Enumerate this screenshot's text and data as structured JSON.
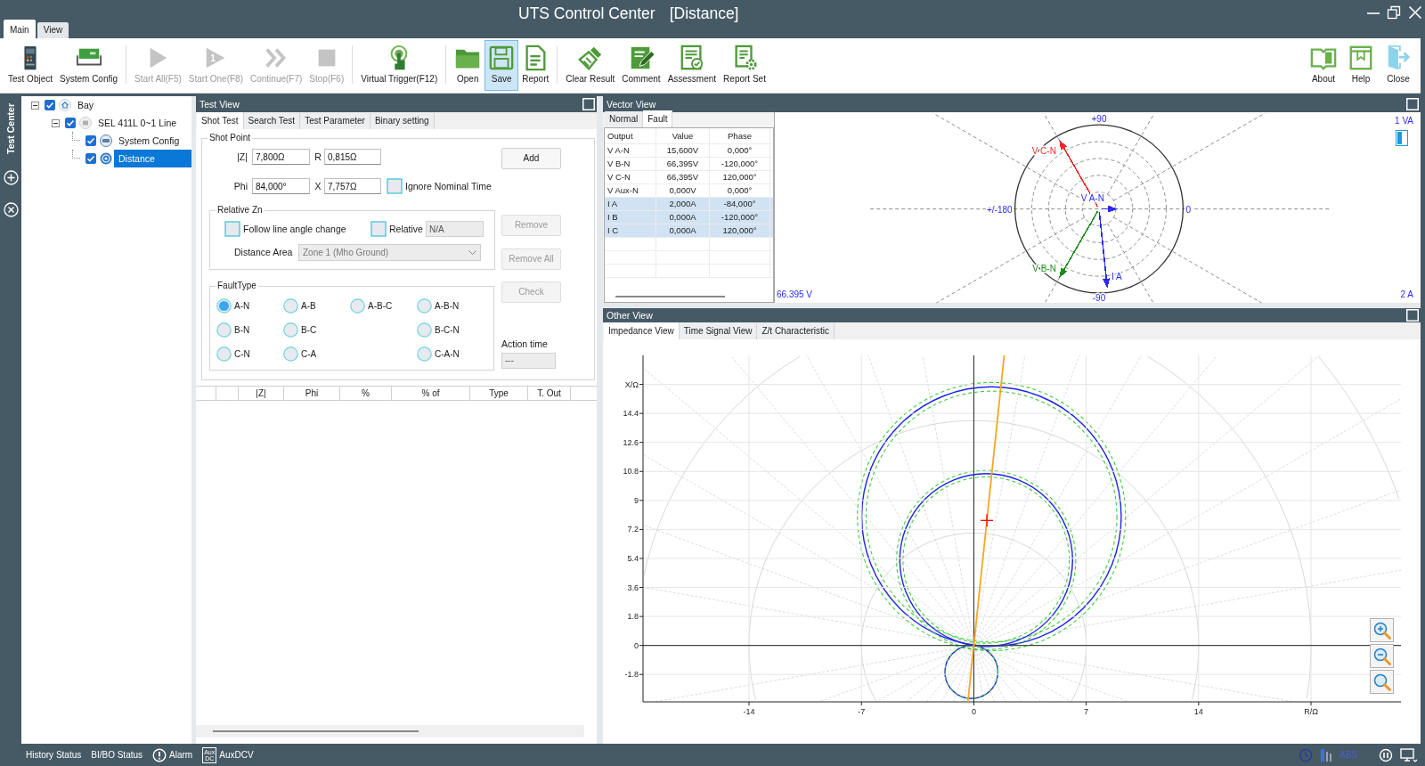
{
  "window": {
    "title": "UTS Control Center",
    "document": "[Distance]"
  },
  "ribbon_tabs": [
    {
      "label": "Main",
      "selected": true
    },
    {
      "label": "View",
      "selected": false
    }
  ],
  "toolbar": {
    "groups": [
      {
        "items": [
          {
            "label": "Test Object",
            "disabled": false,
            "selected": false
          },
          {
            "label": "System Config",
            "disabled": false,
            "selected": false
          }
        ]
      },
      {
        "items": [
          {
            "label": "Start All(F5)",
            "disabled": true,
            "selected": false
          },
          {
            "label": "Start One(F8)",
            "disabled": true,
            "selected": false,
            "icon_text": "1"
          },
          {
            "label": "Continue(F7)",
            "disabled": true,
            "selected": false
          },
          {
            "label": "Stop(F6)",
            "disabled": true,
            "selected": false
          }
        ]
      },
      {
        "items": [
          {
            "label": "Virtual Trigger(F12)",
            "disabled": false,
            "selected": false
          }
        ]
      },
      {
        "items": [
          {
            "label": "Open",
            "disabled": false,
            "selected": false
          },
          {
            "label": "Save",
            "disabled": false,
            "selected": true
          },
          {
            "label": "Report",
            "disabled": false,
            "selected": false
          }
        ]
      },
      {
        "items": [
          {
            "label": "Clear Result",
            "disabled": false,
            "selected": false
          },
          {
            "label": "Comment",
            "disabled": false,
            "selected": false
          },
          {
            "label": "Assessment",
            "disabled": false,
            "selected": false
          },
          {
            "label": "Report Set",
            "disabled": false,
            "selected": false
          }
        ]
      }
    ],
    "right": [
      {
        "label": "About",
        "disabled": false,
        "selected": false
      },
      {
        "label": "Help",
        "disabled": false,
        "selected": false
      },
      {
        "label": "Close",
        "disabled": false,
        "selected": false
      }
    ]
  },
  "side_strip": {
    "label": "Test Center"
  },
  "tree": [
    {
      "label": "Bay",
      "kind": "bay",
      "checked": true,
      "expanded": true,
      "selected": false,
      "children": [
        {
          "label": "SEL 411L 0~1 Line",
          "kind": "device",
          "checked": true,
          "expanded": true,
          "selected": false,
          "children": [
            {
              "label": "System Config",
              "kind": "config",
              "checked": true,
              "selected": false
            },
            {
              "label": "Distance",
              "kind": "test",
              "checked": true,
              "selected": true
            }
          ]
        }
      ]
    }
  ],
  "test_view": {
    "title": "Test View",
    "tabs": [
      {
        "label": "Shot Test",
        "selected": true
      },
      {
        "label": "Search Test",
        "selected": false
      },
      {
        "label": "Test Parameter",
        "selected": false
      },
      {
        "label": "Binary setting",
        "selected": false
      }
    ],
    "shot_point": {
      "legend": "Shot Point",
      "z": {
        "label": "|Z|",
        "value": "7,800Ω"
      },
      "r": {
        "label": "R",
        "value": "0,815Ω"
      },
      "phi": {
        "label": "Phi",
        "value": "84,000°"
      },
      "x": {
        "label": "X",
        "value": "7,757Ω"
      },
      "ignore_nominal_time": {
        "label": "Ignore Nominal Time",
        "checked": false
      },
      "relative_zn": {
        "legend": "Relative Zn",
        "follow_line_angle": {
          "label": "Follow line angle change",
          "checked": false
        },
        "relative": {
          "label": "Relative",
          "checked": false,
          "value": "N/A",
          "disabled": true
        },
        "distance_area": {
          "label": "Distance Area",
          "value": "Zone 1 (Mho Ground)",
          "disabled": true
        }
      },
      "fault_type": {
        "legend": "FaultType",
        "columns": [
          [
            {
              "label": "A-N",
              "selected": true
            },
            {
              "label": "B-N",
              "selected": false
            },
            {
              "label": "C-N",
              "selected": false
            }
          ],
          [
            {
              "label": "A-B",
              "selected": false
            },
            {
              "label": "B-C",
              "selected": false
            },
            {
              "label": "C-A",
              "selected": false
            }
          ],
          [
            {
              "label": "A-B-C",
              "selected": false
            }
          ],
          [
            {
              "label": "A-B-N",
              "selected": false
            },
            {
              "label": "B-C-N",
              "selected": false
            },
            {
              "label": "C-A-N",
              "selected": false
            }
          ]
        ]
      },
      "buttons": [
        {
          "label": "Add",
          "disabled": false
        },
        {
          "label": "Remove",
          "disabled": true
        },
        {
          "label": "Remove All",
          "disabled": true
        },
        {
          "label": "Check",
          "disabled": true
        }
      ],
      "action_time": {
        "label": "Action time",
        "value": "---",
        "disabled": true
      }
    },
    "result_table": {
      "columns": [
        "|Z|",
        "Phi",
        "%",
        "% of",
        "Type",
        "T. Out"
      ]
    }
  },
  "vector_view": {
    "title": "Vector View",
    "tabs": [
      {
        "label": "Normal",
        "selected": false
      },
      {
        "label": "Fault",
        "selected": true
      }
    ],
    "table": {
      "columns": [
        "Output",
        "Value",
        "Phase"
      ],
      "rows": [
        {
          "cells": [
            "V A-N",
            "15,600V",
            "0,000°"
          ],
          "selected": false,
          "phasor": {
            "label": "V A-N",
            "color": "#2a2af0",
            "kind": "voltage"
          }
        },
        {
          "cells": [
            "V B-N",
            "66,395V",
            "-120,000°"
          ],
          "selected": false,
          "phasor": {
            "label": "V B-N",
            "color": "#1e8c1e",
            "kind": "voltage"
          }
        },
        {
          "cells": [
            "V C-N",
            "66,395V",
            "120,000°"
          ],
          "selected": false,
          "phasor": {
            "label": "V C-N",
            "color": "#f02828",
            "kind": "voltage"
          }
        },
        {
          "cells": [
            "V Aux-N",
            "0,000V",
            "0,000°"
          ],
          "selected": false
        },
        {
          "cells": [
            "I A",
            "2,000A",
            "-84,000°"
          ],
          "selected": true,
          "phasor": {
            "label": "I A",
            "color": "#2a2af0",
            "kind": "current"
          }
        },
        {
          "cells": [
            "I B",
            "0,000A",
            "-120,000°"
          ],
          "selected": true
        },
        {
          "cells": [
            "I C",
            "0,000A",
            "120,000°"
          ],
          "selected": true
        }
      ]
    },
    "angle_labels": [
      "+90",
      "+/-180",
      "0",
      "-90"
    ],
    "power_scale": "1 VA",
    "voltage_scale": "66.395 V",
    "current_scale": "2 A"
  },
  "other_view": {
    "title": "Other View",
    "tabs": [
      {
        "label": "Impedance View",
        "selected": true
      },
      {
        "label": "Time Signal View",
        "selected": false
      },
      {
        "label": "Z/t Characteristic",
        "selected": false
      }
    ],
    "chart_data": {
      "type": "line",
      "x": [
        -0.37,
        1.89
      ],
      "xlim": [
        -20.6,
        26.6
      ],
      "ylim": [
        -3.5,
        18
      ],
      "xticks": [
        -14,
        -7,
        0,
        7,
        14,
        {
          "value": 21,
          "label": "R/Ω"
        }
      ],
      "yticks": [
        -1.8,
        0,
        1.8,
        3.6,
        5.4,
        7.2,
        9,
        10.8,
        12.6,
        14.4,
        {
          "value": 16.2,
          "label": "X/Ω"
        }
      ],
      "grid": true,
      "series": [
        {
          "color": "#f5a623",
          "values": [
            -3.5,
            18
          ]
        }
      ]
    }
  },
  "status_bar": {
    "items": [
      {
        "kind": "text",
        "label": "History Status"
      },
      {
        "kind": "text",
        "label": "BI/BO Status"
      },
      {
        "kind": "alarm",
        "label": "Alarm"
      },
      {
        "kind": "aux",
        "label": "AuxDCV",
        "badge": [
          "Aux",
          "DC"
        ]
      }
    ],
    "mode": "ABS"
  }
}
